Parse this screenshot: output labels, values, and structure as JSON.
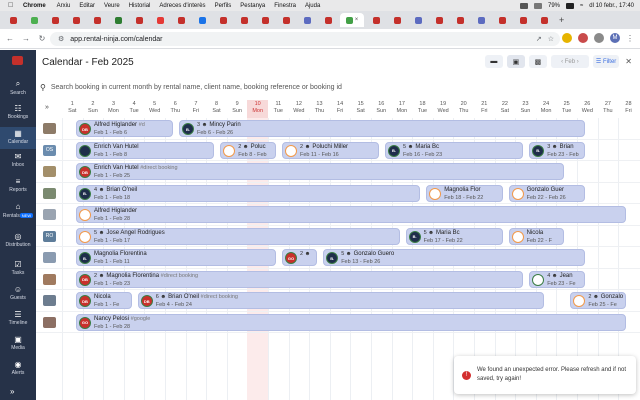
{
  "os_menubar": {
    "app": "Chrome",
    "items": [
      "Arxiu",
      "Editar",
      "Veure",
      "Historial",
      "Adreces d'interès",
      "Perfils",
      "Pestanya",
      "Finestra",
      "Ajuda"
    ],
    "battery": "79%",
    "clock": "dl 10 febr., 17:40"
  },
  "browser": {
    "url": "app.rental-ninja.com/calendar",
    "profile_initial": "M"
  },
  "sidebar": {
    "items": [
      {
        "label": "Search",
        "icon": "search-icon"
      },
      {
        "label": "Bookings",
        "icon": "bookings-icon"
      },
      {
        "label": "Calendar",
        "icon": "calendar-icon"
      },
      {
        "label": "Inbox",
        "icon": "inbox-icon"
      },
      {
        "label": "Reports",
        "icon": "reports-icon"
      },
      {
        "label": "Rentals",
        "icon": "rentals-icon",
        "badge": "NEW"
      },
      {
        "label": "Distribution",
        "icon": "distribution-icon"
      },
      {
        "label": "Tasks",
        "icon": "tasks-icon"
      },
      {
        "label": "Guests",
        "icon": "guests-icon"
      },
      {
        "label": "Timeline",
        "icon": "timeline-icon"
      },
      {
        "label": "Media",
        "icon": "media-icon"
      },
      {
        "label": "Alerts",
        "icon": "alerts-icon"
      }
    ]
  },
  "header": {
    "title": "Calendar - Feb 2025",
    "month_nav": "Feb",
    "filter_label": "Filter",
    "search_placeholder": "Search booking in current month by rental name, client name, booking reference or booking id"
  },
  "days": [
    {
      "n": "1",
      "d": "Sat"
    },
    {
      "n": "2",
      "d": "Sun"
    },
    {
      "n": "3",
      "d": "Mon"
    },
    {
      "n": "4",
      "d": "Tue"
    },
    {
      "n": "5",
      "d": "Wed"
    },
    {
      "n": "6",
      "d": "Thu"
    },
    {
      "n": "7",
      "d": "Fri"
    },
    {
      "n": "8",
      "d": "Sat"
    },
    {
      "n": "9",
      "d": "Sun"
    },
    {
      "n": "10",
      "d": "Mon"
    },
    {
      "n": "11",
      "d": "Tue"
    },
    {
      "n": "12",
      "d": "Wed"
    },
    {
      "n": "13",
      "d": "Thu"
    },
    {
      "n": "14",
      "d": "Fri"
    },
    {
      "n": "15",
      "d": "Sat"
    },
    {
      "n": "16",
      "d": "Sun"
    },
    {
      "n": "17",
      "d": "Mon"
    },
    {
      "n": "18",
      "d": "Tue"
    },
    {
      "n": "19",
      "d": "Wed"
    },
    {
      "n": "20",
      "d": "Thu"
    },
    {
      "n": "21",
      "d": "Fri"
    },
    {
      "n": "22",
      "d": "Sat"
    },
    {
      "n": "23",
      "d": "Sun"
    },
    {
      "n": "24",
      "d": "Mon"
    },
    {
      "n": "25",
      "d": "Tue"
    },
    {
      "n": "26",
      "d": "Wed"
    },
    {
      "n": "27",
      "d": "Thu"
    },
    {
      "n": "28",
      "d": "Fri"
    }
  ],
  "today": "10",
  "rows": [
    {
      "thumb": "",
      "bookings": [
        {
          "start": 1,
          "end": 6,
          "av": "DB",
          "cls": "",
          "people": "",
          "name": "Alfred Higlander",
          "tag": "#d",
          "dates": "Feb 1 - Feb 6"
        },
        {
          "start": 6,
          "end": 26,
          "av": "B.",
          "cls": "b",
          "people": "3",
          "name": "Mincy Parin",
          "tag": "",
          "dates": "Feb 6 - Feb 26"
        }
      ]
    },
    {
      "thumb": "OS",
      "bookings": [
        {
          "start": 1,
          "end": 8,
          "av": "",
          "cls": "b",
          "people": "",
          "name": "Enrich Van Hutel",
          "tag": "",
          "dates": "Feb 1 - Feb 8"
        },
        {
          "start": 8,
          "end": 11,
          "av": "",
          "cls": "g",
          "people": "2",
          "name": "Poluc",
          "tag": "",
          "dates": "Feb 8 - Feb"
        },
        {
          "start": 11,
          "end": 16,
          "av": "",
          "cls": "g",
          "people": "2",
          "name": "Poluchi Miller",
          "tag": "",
          "dates": "Feb 11 - Feb 16"
        },
        {
          "start": 16,
          "end": 23,
          "av": "B.",
          "cls": "b",
          "people": "5",
          "name": "Maria Bc",
          "tag": "",
          "dates": "Feb 16 - Feb 23"
        },
        {
          "start": 23,
          "end": 26,
          "av": "B.",
          "cls": "b",
          "people": "3",
          "name": "Brian",
          "tag": "",
          "dates": "Feb 23 - Feb"
        }
      ]
    },
    {
      "thumb": "",
      "bookings": [
        {
          "start": 1,
          "end": 25,
          "av": "DB",
          "cls": "",
          "people": "",
          "name": "Enrich Van Hutel",
          "tag": "#direct booking",
          "dates": "Feb 1 - Feb 25"
        }
      ]
    },
    {
      "thumb": "",
      "bookings": [
        {
          "start": 1,
          "end": 18,
          "av": "B.",
          "cls": "b",
          "people": "4",
          "name": "Brian O'neil",
          "tag": "",
          "dates": "Feb 1 - Feb 18"
        },
        {
          "start": 18,
          "end": 22,
          "av": "",
          "cls": "g",
          "people": "",
          "name": "Magnolia Flor",
          "tag": "",
          "dates": "Feb 18 - Feb 22"
        },
        {
          "start": 22,
          "end": 26,
          "av": "",
          "cls": "g",
          "people": "",
          "name": "Gonzalo Guer",
          "tag": "",
          "dates": "Feb 22 - Feb 26"
        }
      ]
    },
    {
      "thumb": "",
      "bookings": [
        {
          "start": 1,
          "end": 28,
          "av": "",
          "cls": "g",
          "people": "",
          "name": "Alfred Higlander",
          "tag": "",
          "dates": "Feb 1 - Feb 28"
        }
      ]
    },
    {
      "thumb": "RO",
      "bookings": [
        {
          "start": 1,
          "end": 17,
          "av": "",
          "cls": "g",
          "people": "5",
          "name": "Jose Angel Rodrigues",
          "tag": "",
          "dates": "Feb 1 - Feb 17"
        },
        {
          "start": 17,
          "end": 22,
          "av": "B.",
          "cls": "b",
          "people": "5",
          "name": "Maria Bc",
          "tag": "",
          "dates": "Feb 17 - Feb 22"
        },
        {
          "start": 22,
          "end": 25,
          "av": "",
          "cls": "g",
          "people": "",
          "name": "Nicola",
          "tag": "",
          "dates": "Feb 22 - F"
        }
      ]
    },
    {
      "thumb": "",
      "bookings": [
        {
          "start": 1,
          "end": 11,
          "av": "B.",
          "cls": "b",
          "people": "",
          "name": "Magnolia Florentina",
          "tag": "",
          "dates": "Feb 1 - Feb 11"
        },
        {
          "start": 11,
          "end": 13,
          "av": "GO",
          "cls": "",
          "people": "2",
          "name": "",
          "tag": "",
          "dates": ""
        },
        {
          "start": 13,
          "end": 26,
          "av": "B.",
          "cls": "b",
          "people": "5",
          "name": "Gonzalo Guero",
          "tag": "",
          "dates": "Feb 13 - Feb 26"
        }
      ]
    },
    {
      "thumb": "",
      "bookings": [
        {
          "start": 1,
          "end": 23,
          "av": "DB",
          "cls": "",
          "people": "2",
          "name": "Magnolia Florentina",
          "tag": "#direct booking",
          "dates": "Feb 1 - Feb 23"
        },
        {
          "start": 23,
          "end": 26,
          "av": "",
          "cls": "a",
          "people": "4",
          "name": "Jean",
          "tag": "",
          "dates": "Feb 23 - Fe"
        }
      ]
    },
    {
      "thumb": "",
      "bookings": [
        {
          "start": 1,
          "end": 4,
          "av": "DB",
          "cls": "",
          "people": "",
          "name": "Nicola",
          "tag": "",
          "dates": "Feb 1 - Fe"
        },
        {
          "start": 4,
          "end": 24,
          "av": "DB",
          "cls": "",
          "people": "6",
          "name": "Brian O'neil",
          "tag": "#direct booking",
          "dates": "Feb 4 - Feb 24"
        },
        {
          "start": 25,
          "end": 28,
          "av": "",
          "cls": "g",
          "people": "2",
          "name": "Gonzalo",
          "tag": "",
          "dates": "Feb 25 - Fe"
        }
      ]
    },
    {
      "thumb": "",
      "bookings": [
        {
          "start": 1,
          "end": 28,
          "av": "GO",
          "cls": "",
          "people": "",
          "name": "Nancy Pelosi",
          "tag": "#google",
          "dates": "Feb 1 - Feb 28"
        }
      ]
    }
  ],
  "error_toast": {
    "message": "We found an unexpected error. Please refresh and if not saved, try again!"
  }
}
